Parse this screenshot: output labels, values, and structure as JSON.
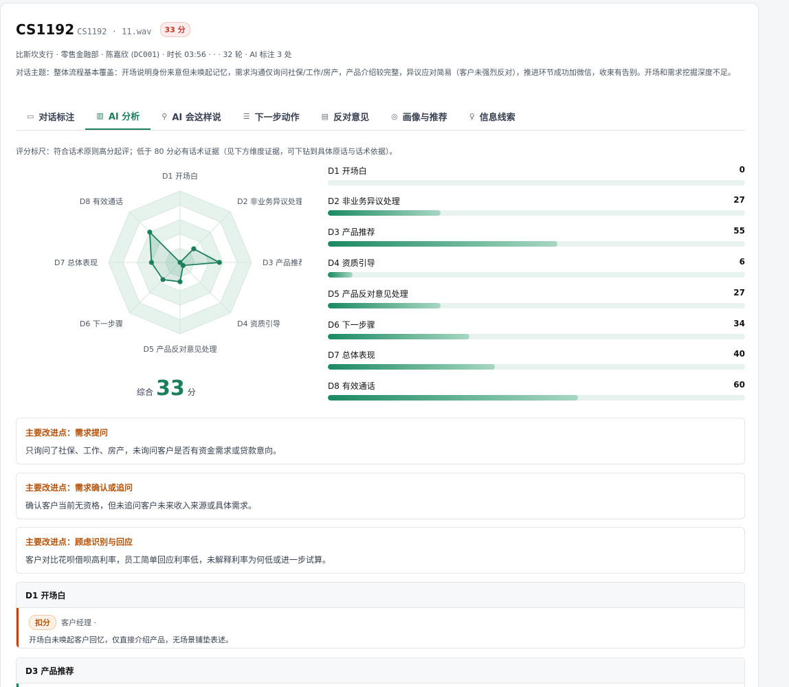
{
  "header": {
    "title": "CS1192",
    "file": "CS1192 · 11.wav",
    "score_badge": "33 分",
    "meta_prefix": "比斯坎支行 · 零售金融部 · 陈嘉欣 (",
    "meta_code": "DC001",
    "meta_suffix": ") · 时长 03:56 · · · 32 轮 · AI 标注 3 处",
    "topic": "对话主题：整体流程基本覆盖：开场说明身份来意但未唤起记忆，需求沟通仅询问社保/工作/房产，产品介绍较完整，异议应对简易（客户未强烈反对），推进环节成功加微信，收束有告别。开场和需求挖掘深度不足。"
  },
  "tabs": [
    {
      "label": "对话标注",
      "icon": "chat-icon"
    },
    {
      "label": "AI 分析",
      "icon": "chart-icon",
      "active": true
    },
    {
      "label": "AI 会这样说",
      "icon": "magic-icon"
    },
    {
      "label": "下一步动作",
      "icon": "checklist-icon"
    },
    {
      "label": "反对意见",
      "icon": "comment-icon"
    },
    {
      "label": "画像与推荐",
      "icon": "target-icon"
    },
    {
      "label": "信息线索",
      "icon": "bulb-icon"
    }
  ],
  "rubric": "评分标尺：符合话术原则高分起评；低于 80 分必有话术证据（见下方维度证据，可下钻到具体原话与话术依据）。",
  "chart_data": {
    "type": "radar",
    "categories": [
      "D1 开场白",
      "D2 非业务异议处理",
      "D3 产品推荐",
      "D4 资质引导",
      "D5 产品反对意见处理",
      "D6 下一步骤",
      "D7 总体表现",
      "D8 有效通话"
    ],
    "values": [
      0,
      27,
      55,
      6,
      27,
      34,
      40,
      60
    ],
    "range": [
      0,
      100
    ],
    "accent": "#1a7f5a"
  },
  "total": {
    "label": "综合",
    "value": "33",
    "unit": "分"
  },
  "bars": [
    {
      "label": "D1 开场白",
      "value": "0"
    },
    {
      "label": "D2 非业务异议处理",
      "value": "27"
    },
    {
      "label": "D3 产品推荐",
      "value": "55"
    },
    {
      "label": "D4 资质引导",
      "value": "6"
    },
    {
      "label": "D5 产品反对意见处理",
      "value": "27"
    },
    {
      "label": "D6 下一步骤",
      "value": "34"
    },
    {
      "label": "D7 总体表现",
      "value": "40"
    },
    {
      "label": "D8 有效通话",
      "value": "60"
    }
  ],
  "notes": [
    {
      "title": "主要改进点：需求提问",
      "body": "只询问了社保、工作、房产，未询问客户是否有资金需求或贷款意向。"
    },
    {
      "title": "主要改进点：需求确认或追问",
      "body": "确认客户当前无资格，但未追问客户未来收入来源或具体需求。"
    },
    {
      "title": "主要改进点：顾虑识别与回应",
      "body": "客户对比花呗借呗高利率，员工简单回应利率低，未解释利率为何低或进一步试算。"
    }
  ],
  "dims": [
    {
      "title": "D1 开场白",
      "tag": "扣分",
      "who": "客户经理 ·",
      "text": "开场白未唤起客户回忆，仅直接介绍产品，无场景铺垫表述。"
    },
    {
      "title": "D3 产品推荐"
    }
  ]
}
